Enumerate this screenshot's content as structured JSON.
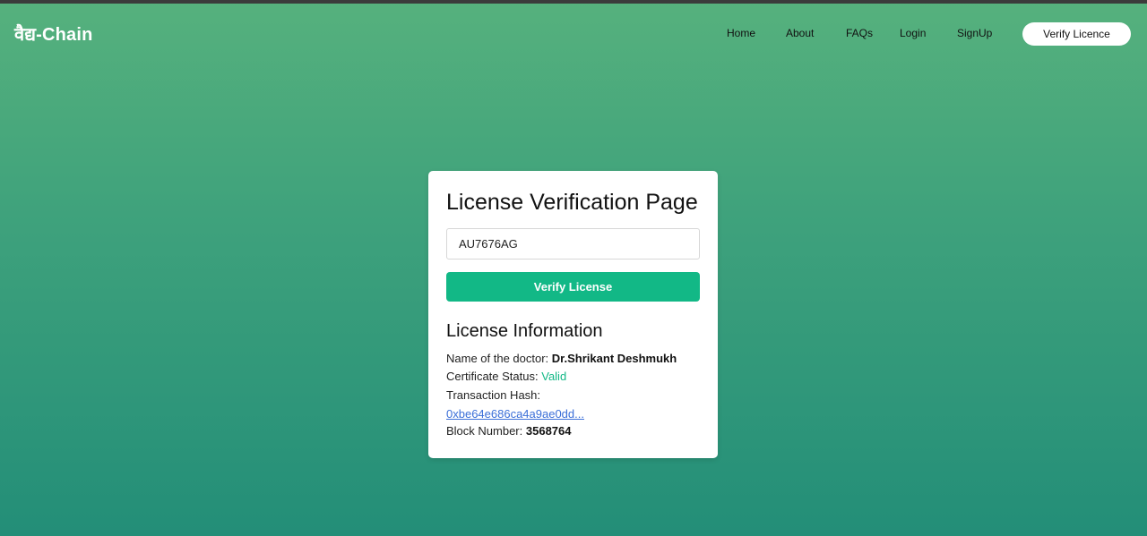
{
  "nav": {
    "brand": "वैद्य-Chain",
    "links": [
      "Home",
      "About",
      "FAQs",
      "Login",
      "SignUp"
    ],
    "verify_button": "Verify Licence"
  },
  "card": {
    "title": "License Verification Page",
    "input_value": "AU7676AG",
    "verify_button": "Verify License"
  },
  "info": {
    "title": "License Information",
    "doctor_label": "Name of the doctor:",
    "doctor_name": "Dr.Shrikant Deshmukh",
    "status_label": "Certificate Status:",
    "status_value": "Valid",
    "hash_label": "Transaction Hash:",
    "hash_value": "0xbe64e686ca4a9ae0dd...",
    "block_label": "Block Number:",
    "block_value": "3568764"
  },
  "colors": {
    "accent": "#12b886",
    "link": "#3b6fd8",
    "gradient_top": "#56b17d",
    "gradient_bottom": "#238e78"
  }
}
